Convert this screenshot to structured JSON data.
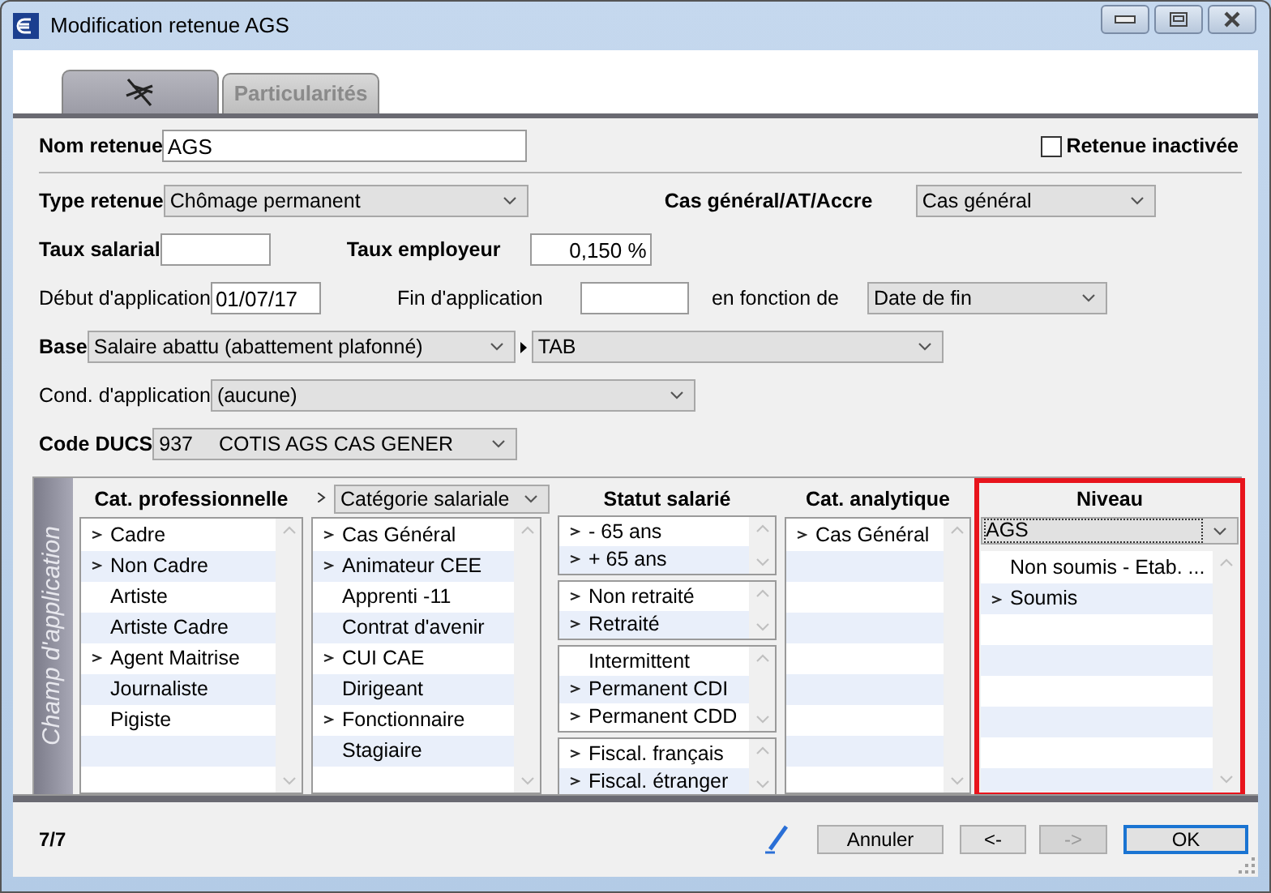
{
  "window": {
    "title": "Modification retenue AGS"
  },
  "tabs": [
    {
      "kind": "icon",
      "selected": true
    },
    {
      "kind": "text",
      "label": "Particularités",
      "selected": false
    }
  ],
  "form": {
    "nom_retenue": {
      "label": "Nom retenue",
      "required": true,
      "value": "AGS"
    },
    "retenue_inactivee": {
      "label": "Retenue inactivée",
      "checked": false
    },
    "type_retenue": {
      "label": "Type retenue",
      "required": true,
      "value": "Chômage permanent"
    },
    "cas_general": {
      "label": "Cas général/AT/Accre",
      "required": true,
      "value": "Cas général"
    },
    "taux_salarial": {
      "label": "Taux salarial",
      "required": true
    },
    "taux_employeur": {
      "label": "Taux employeur",
      "required": true,
      "value": "0,150 %"
    },
    "debut": {
      "label": "Début d'application",
      "required": false,
      "value": "01/07/17"
    },
    "fin": {
      "label": "Fin d'application",
      "required": false
    },
    "en_fonction_de": {
      "label": "en fonction de",
      "required": false,
      "value": "Date de fin"
    },
    "base": {
      "label": "Base",
      "required": true,
      "value": "Salaire abattu (abattement plafonné)",
      "sub_value": "TAB"
    },
    "cond": {
      "label": "Cond. d'application",
      "required": false,
      "value": "(aucune)"
    },
    "code_ducs": {
      "label": "Code DUCS",
      "required": true,
      "code": "937",
      "value": "COTIS AGS CAS GENER"
    }
  },
  "scope": {
    "side_label": "Champ d'application",
    "cat_pro": {
      "header": "Cat. professionnelle",
      "items": [
        {
          "label": "Cadre",
          "marked": true
        },
        {
          "label": "Non Cadre",
          "marked": true
        },
        {
          "label": "Artiste",
          "marked": false
        },
        {
          "label": "Artiste Cadre",
          "marked": false
        },
        {
          "label": "Agent Maitrise",
          "marked": true
        },
        {
          "label": "Journaliste",
          "marked": false
        },
        {
          "label": "Pigiste",
          "marked": false
        }
      ]
    },
    "cat_sal": {
      "dropdown": "Catégorie salariale",
      "items": [
        {
          "label": "Cas Général",
          "marked": true
        },
        {
          "label": "Animateur CEE",
          "marked": true
        },
        {
          "label": "Apprenti -11",
          "marked": false
        },
        {
          "label": "Contrat d'avenir",
          "marked": false
        },
        {
          "label": "CUI CAE",
          "marked": true
        },
        {
          "label": "Dirigeant",
          "marked": false
        },
        {
          "label": "Fonctionnaire",
          "marked": true
        },
        {
          "label": "Stagiaire",
          "marked": false
        }
      ]
    },
    "statut": {
      "header": "Statut salarié",
      "groups": [
        [
          {
            "label": "- 65 ans",
            "marked": true
          },
          {
            "label": "+ 65 ans",
            "marked": true
          }
        ],
        [
          {
            "label": "Non retraité",
            "marked": true
          },
          {
            "label": "Retraité",
            "marked": true
          }
        ],
        [
          {
            "label": "Intermittent",
            "marked": false
          },
          {
            "label": "Permanent CDI",
            "marked": true
          },
          {
            "label": "Permanent CDD",
            "marked": true
          }
        ],
        [
          {
            "label": "Fiscal. français",
            "marked": true
          },
          {
            "label": "Fiscal. étranger",
            "marked": true
          }
        ]
      ]
    },
    "cat_analytique": {
      "header": "Cat. analytique",
      "items": [
        {
          "label": "Cas Général",
          "marked": true
        }
      ]
    },
    "niveau": {
      "header": "Niveau",
      "highlighted": true,
      "dropdown": "AGS",
      "items": [
        {
          "label": "Non soumis - Etab. ...",
          "marked": false
        },
        {
          "label": "Soumis",
          "marked": true
        }
      ]
    }
  },
  "footer": {
    "counter": "7/7",
    "buttons": [
      {
        "label": "Annuler",
        "disabled": false,
        "default": false
      },
      {
        "label": "<-",
        "disabled": false,
        "default": false
      },
      {
        "label": "->",
        "disabled": true,
        "default": false
      },
      {
        "label": "OK",
        "disabled": false,
        "default": true
      }
    ]
  }
}
